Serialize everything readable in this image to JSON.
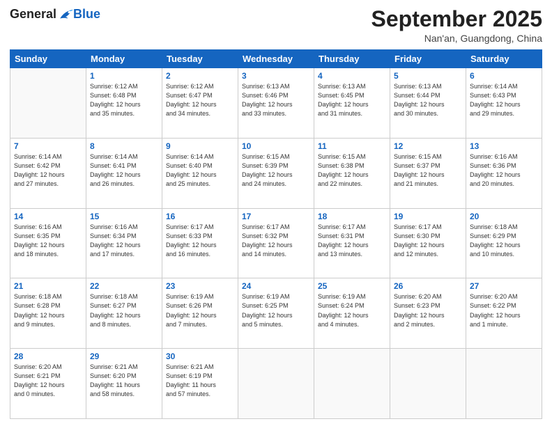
{
  "logo": {
    "general": "General",
    "blue": "Blue"
  },
  "title": "September 2025",
  "location": "Nan'an, Guangdong, China",
  "days_header": [
    "Sunday",
    "Monday",
    "Tuesday",
    "Wednesday",
    "Thursday",
    "Friday",
    "Saturday"
  ],
  "weeks": [
    [
      {
        "num": "",
        "info": ""
      },
      {
        "num": "1",
        "info": "Sunrise: 6:12 AM\nSunset: 6:48 PM\nDaylight: 12 hours\nand 35 minutes."
      },
      {
        "num": "2",
        "info": "Sunrise: 6:12 AM\nSunset: 6:47 PM\nDaylight: 12 hours\nand 34 minutes."
      },
      {
        "num": "3",
        "info": "Sunrise: 6:13 AM\nSunset: 6:46 PM\nDaylight: 12 hours\nand 33 minutes."
      },
      {
        "num": "4",
        "info": "Sunrise: 6:13 AM\nSunset: 6:45 PM\nDaylight: 12 hours\nand 31 minutes."
      },
      {
        "num": "5",
        "info": "Sunrise: 6:13 AM\nSunset: 6:44 PM\nDaylight: 12 hours\nand 30 minutes."
      },
      {
        "num": "6",
        "info": "Sunrise: 6:14 AM\nSunset: 6:43 PM\nDaylight: 12 hours\nand 29 minutes."
      }
    ],
    [
      {
        "num": "7",
        "info": "Sunrise: 6:14 AM\nSunset: 6:42 PM\nDaylight: 12 hours\nand 27 minutes."
      },
      {
        "num": "8",
        "info": "Sunrise: 6:14 AM\nSunset: 6:41 PM\nDaylight: 12 hours\nand 26 minutes."
      },
      {
        "num": "9",
        "info": "Sunrise: 6:14 AM\nSunset: 6:40 PM\nDaylight: 12 hours\nand 25 minutes."
      },
      {
        "num": "10",
        "info": "Sunrise: 6:15 AM\nSunset: 6:39 PM\nDaylight: 12 hours\nand 24 minutes."
      },
      {
        "num": "11",
        "info": "Sunrise: 6:15 AM\nSunset: 6:38 PM\nDaylight: 12 hours\nand 22 minutes."
      },
      {
        "num": "12",
        "info": "Sunrise: 6:15 AM\nSunset: 6:37 PM\nDaylight: 12 hours\nand 21 minutes."
      },
      {
        "num": "13",
        "info": "Sunrise: 6:16 AM\nSunset: 6:36 PM\nDaylight: 12 hours\nand 20 minutes."
      }
    ],
    [
      {
        "num": "14",
        "info": "Sunrise: 6:16 AM\nSunset: 6:35 PM\nDaylight: 12 hours\nand 18 minutes."
      },
      {
        "num": "15",
        "info": "Sunrise: 6:16 AM\nSunset: 6:34 PM\nDaylight: 12 hours\nand 17 minutes."
      },
      {
        "num": "16",
        "info": "Sunrise: 6:17 AM\nSunset: 6:33 PM\nDaylight: 12 hours\nand 16 minutes."
      },
      {
        "num": "17",
        "info": "Sunrise: 6:17 AM\nSunset: 6:32 PM\nDaylight: 12 hours\nand 14 minutes."
      },
      {
        "num": "18",
        "info": "Sunrise: 6:17 AM\nSunset: 6:31 PM\nDaylight: 12 hours\nand 13 minutes."
      },
      {
        "num": "19",
        "info": "Sunrise: 6:17 AM\nSunset: 6:30 PM\nDaylight: 12 hours\nand 12 minutes."
      },
      {
        "num": "20",
        "info": "Sunrise: 6:18 AM\nSunset: 6:29 PM\nDaylight: 12 hours\nand 10 minutes."
      }
    ],
    [
      {
        "num": "21",
        "info": "Sunrise: 6:18 AM\nSunset: 6:28 PM\nDaylight: 12 hours\nand 9 minutes."
      },
      {
        "num": "22",
        "info": "Sunrise: 6:18 AM\nSunset: 6:27 PM\nDaylight: 12 hours\nand 8 minutes."
      },
      {
        "num": "23",
        "info": "Sunrise: 6:19 AM\nSunset: 6:26 PM\nDaylight: 12 hours\nand 7 minutes."
      },
      {
        "num": "24",
        "info": "Sunrise: 6:19 AM\nSunset: 6:25 PM\nDaylight: 12 hours\nand 5 minutes."
      },
      {
        "num": "25",
        "info": "Sunrise: 6:19 AM\nSunset: 6:24 PM\nDaylight: 12 hours\nand 4 minutes."
      },
      {
        "num": "26",
        "info": "Sunrise: 6:20 AM\nSunset: 6:23 PM\nDaylight: 12 hours\nand 2 minutes."
      },
      {
        "num": "27",
        "info": "Sunrise: 6:20 AM\nSunset: 6:22 PM\nDaylight: 12 hours\nand 1 minute."
      }
    ],
    [
      {
        "num": "28",
        "info": "Sunrise: 6:20 AM\nSunset: 6:21 PM\nDaylight: 12 hours\nand 0 minutes."
      },
      {
        "num": "29",
        "info": "Sunrise: 6:21 AM\nSunset: 6:20 PM\nDaylight: 11 hours\nand 58 minutes."
      },
      {
        "num": "30",
        "info": "Sunrise: 6:21 AM\nSunset: 6:19 PM\nDaylight: 11 hours\nand 57 minutes."
      },
      {
        "num": "",
        "info": ""
      },
      {
        "num": "",
        "info": ""
      },
      {
        "num": "",
        "info": ""
      },
      {
        "num": "",
        "info": ""
      }
    ]
  ]
}
